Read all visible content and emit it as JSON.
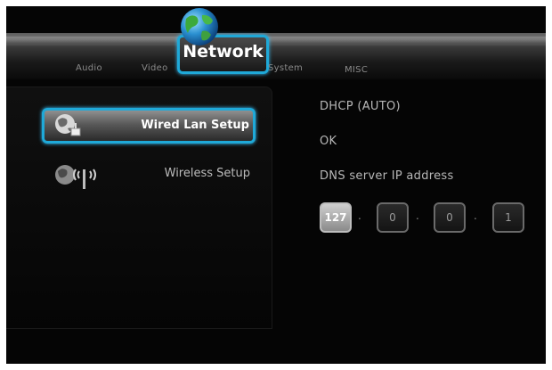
{
  "tabs": [
    {
      "label": "Audio"
    },
    {
      "label": "Video"
    },
    {
      "label": "Network",
      "active": true
    },
    {
      "label": "System"
    },
    {
      "label": "MISC"
    }
  ],
  "menu": [
    {
      "label": "Wired Lan Setup",
      "icon": "wired-lan-icon",
      "selected": true
    },
    {
      "label": "Wireless Setup",
      "icon": "wireless-icon",
      "selected": false
    }
  ],
  "info": {
    "mode": "DHCP (AUTO)",
    "status": "OK",
    "dns_label": "DNS server IP address"
  },
  "dns": {
    "octets": [
      "127",
      "0",
      "0",
      "1"
    ],
    "separator": "."
  },
  "colors": {
    "accent": "#1fa9d8",
    "background": "#050505",
    "text": "#b8b8b8"
  }
}
